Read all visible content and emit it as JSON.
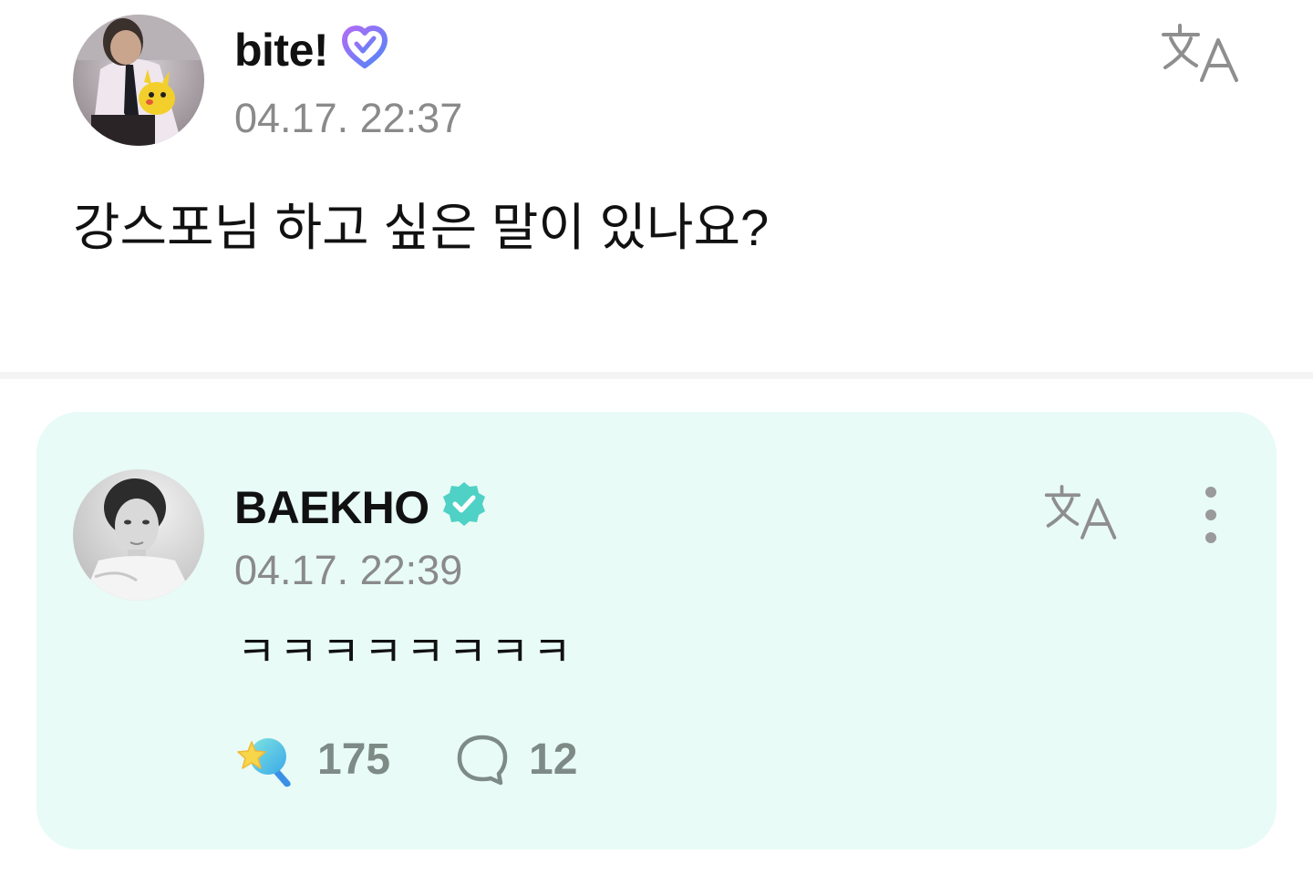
{
  "post": {
    "author": "bite!",
    "timestamp": "04.17. 22:37",
    "text": "강스포님 하고 싶은 말이 있나요?",
    "avatar_icon": "user-photo-avatar",
    "badge_icon": "purple-heart-badge-icon",
    "badge_color": "#8a5cf6"
  },
  "reply": {
    "author": "BAEKHO",
    "timestamp": "04.17. 22:39",
    "text": "ㅋㅋㅋㅋㅋㅋㅋㅋ",
    "avatar_icon": "artist-photo-avatar",
    "badge_icon": "verified-badge-icon",
    "badge_color": "#4fd1c5",
    "like_count": "175",
    "comment_count": "12",
    "card_color": "#e8fbf6"
  },
  "icons": {
    "translate": "translate-icon",
    "more": "more-vertical-icon",
    "like": "star-lightstick-icon",
    "comment": "comment-bubble-icon"
  }
}
